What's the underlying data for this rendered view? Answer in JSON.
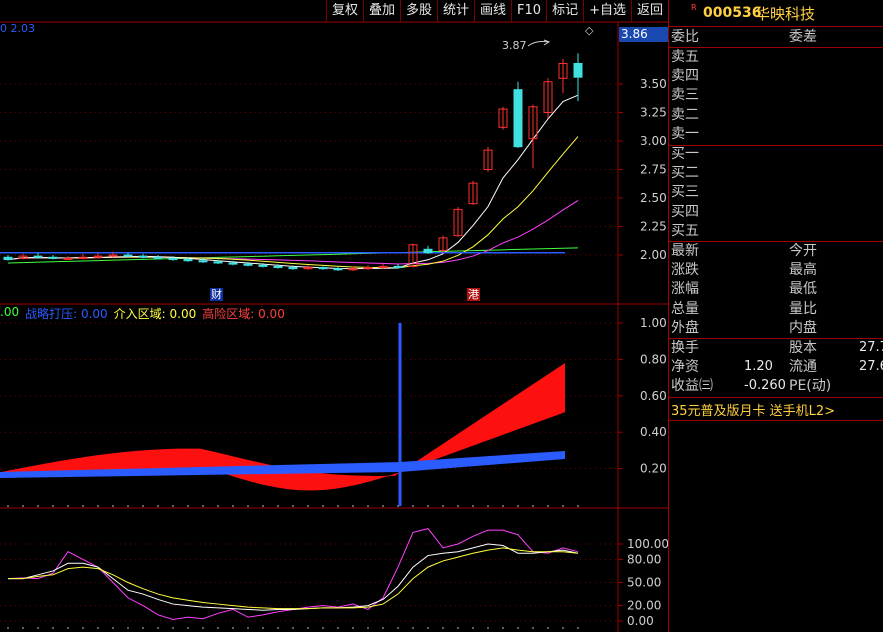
{
  "toolbar": {
    "buttons": [
      "复权",
      "叠加",
      "多股",
      "统计",
      "画线",
      "F10",
      "标记",
      "+自选",
      "返回"
    ]
  },
  "main_chart": {
    "top_left_value": "0  2.03",
    "current_price_tag": "3.86",
    "peak_label": "3.87",
    "marker_diamond": "◇",
    "price_axis": [
      "3.50",
      "3.25",
      "3.00",
      "2.75",
      "2.50",
      "2.25",
      "2.00"
    ],
    "event_markers": [
      "财",
      "港"
    ]
  },
  "indicator1": {
    "legend_prefix": ".00",
    "legend_items": [
      {
        "label": "战略打压: 0.00",
        "color": "#2a5cff"
      },
      {
        "label": "介入区域: 0.00",
        "color": "#ffff40"
      },
      {
        "label": "高险区域: 0.00",
        "color": "#ff4040"
      }
    ],
    "axis": [
      "1.00",
      "0.80",
      "0.60",
      "0.40",
      "0.20"
    ]
  },
  "indicator2": {
    "axis": [
      "100.00",
      "80.00",
      "50.00",
      "20.00",
      "0.00"
    ]
  },
  "stock": {
    "superscript": "R",
    "code": "000536",
    "name": "华映科技"
  },
  "order_book": {
    "header_left": "委比",
    "header_right": "委差",
    "sell_levels": [
      "卖五",
      "卖四",
      "卖三",
      "卖二",
      "卖一"
    ],
    "buy_levels": [
      "买一",
      "买二",
      "买三",
      "买四",
      "买五"
    ]
  },
  "stats": {
    "rows": [
      {
        "left": "最新",
        "right": "今开"
      },
      {
        "left": "涨跌",
        "right": "最高"
      },
      {
        "left": "涨幅",
        "right": "最低"
      },
      {
        "left": "总量",
        "right": "量比"
      },
      {
        "left": "外盘",
        "right": "内盘"
      }
    ]
  },
  "fundamentals": {
    "rows": [
      {
        "left": "换手",
        "left_value": "",
        "right": "股本",
        "right_value": "27.7"
      },
      {
        "left": "净资",
        "left_value": "1.20",
        "right": "流通",
        "right_value": "27.6"
      },
      {
        "left": "收益㈢",
        "left_value": "-0.260",
        "right": "PE(动)",
        "right_value": ""
      }
    ]
  },
  "promo": {
    "text": "35元普及版月卡 送手机L2>"
  },
  "colors": {
    "up": "#ff3030",
    "down": "#40e0e0",
    "ma5": "#ffffff",
    "ma10": "#ffff40",
    "ma20": "#ff40ff",
    "ma60": "#40ff40",
    "indicator_blue": "#2a5cff",
    "frame": "#a00000",
    "accent_gold": "#ffd040"
  }
}
